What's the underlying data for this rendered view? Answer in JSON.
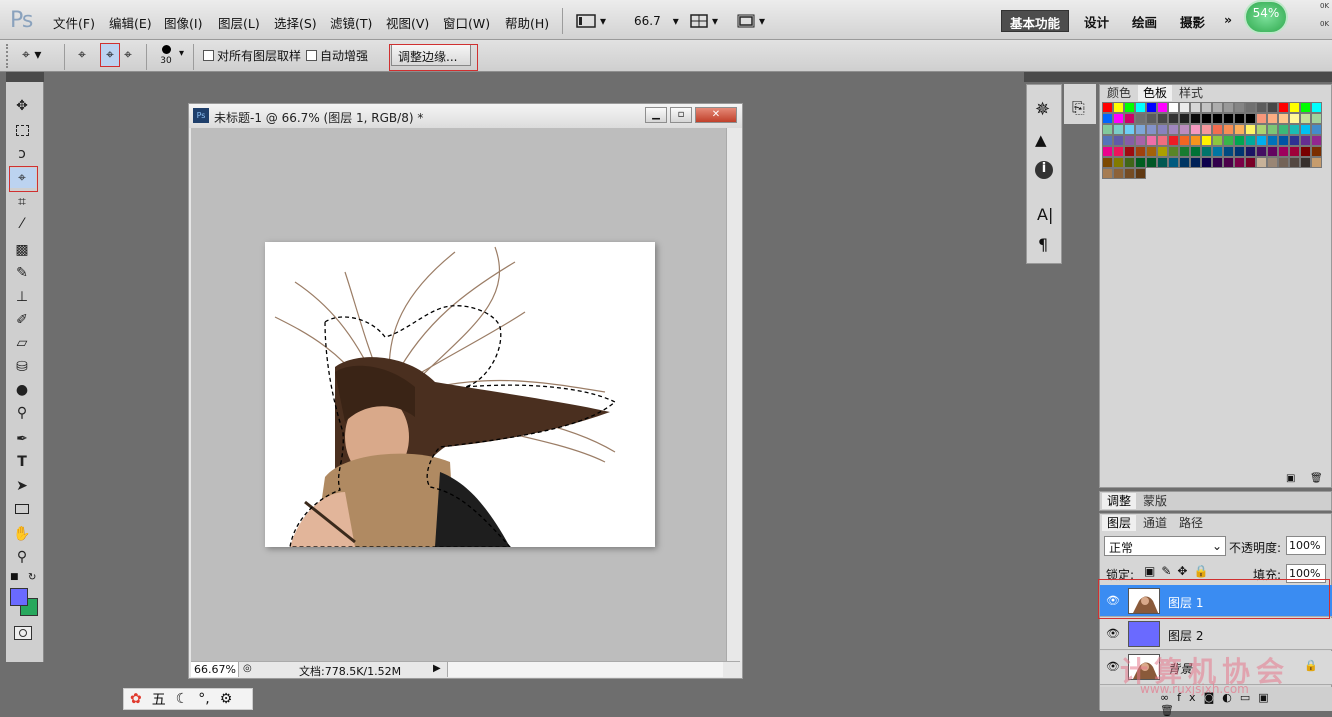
{
  "app": {
    "logo": "Ps"
  },
  "menu": [
    "文件(F)",
    "编辑(E)",
    "图像(I)",
    "图层(L)",
    "选择(S)",
    "滤镜(T)",
    "视图(V)",
    "窗口(W)",
    "帮助(H)"
  ],
  "menubar": {
    "zoom": "66.7",
    "zoom_dropdown": "▾"
  },
  "workspaces": {
    "active": "基本功能",
    "items": [
      "设计",
      "绘画",
      "摄影"
    ],
    "more": "»"
  },
  "tray": {
    "badge": "54%",
    "net_up": "0K",
    "net_down": "0K"
  },
  "options": {
    "brush_size": "30",
    "sample_all_layers": "对所有图层取样",
    "auto_enhance": "自动增强",
    "refine_edge": "调整边缘..."
  },
  "document": {
    "title": "未标题-1 @ 66.7% (图层 1, RGB/8) *",
    "zoom_status": "66.67%",
    "doc_size": "文档:778.5K/1.52M",
    "ps_badge": "Ps"
  },
  "swatch_tabs": [
    "颜色",
    "色板",
    "样式"
  ],
  "swatch_active": 1,
  "swatch_colors": [
    "#ff0000",
    "#ffff00",
    "#00ff00",
    "#00ffff",
    "#0000ff",
    "#ff00ff",
    "#ffffff",
    "#ebebeb",
    "#d6d6d6",
    "#c2c2c2",
    "#adadad",
    "#999999",
    "#858585",
    "#707070",
    "#5c5c5c",
    "#474747",
    "#ff0000",
    "#ffff00",
    "#00ff00",
    "#00ffff",
    "#0066ff",
    "#ff00ff",
    "#cc0066",
    "#707070",
    "#5c5c5c",
    "#474747",
    "#333333",
    "#1f1f1f",
    "#0a0a0a",
    "#000000",
    "#000000",
    "#000000",
    "#000000",
    "#000000",
    "#f7977a",
    "#fbad82",
    "#fdc68c",
    "#fff799",
    "#c4df9b",
    "#a3d39c",
    "#82ca9c",
    "#7bcdc8",
    "#6ecff6",
    "#7ea7d8",
    "#8493ca",
    "#8882be",
    "#a187be",
    "#bc8dbf",
    "#f49ac1",
    "#f5989d",
    "#f26c4f",
    "#f68e55",
    "#fbaf5c",
    "#fff467",
    "#acd372",
    "#7cc576",
    "#3bb878",
    "#1abbb4",
    "#00bff3",
    "#438ccb",
    "#5574b9",
    "#605ca8",
    "#855fa8",
    "#a763a9",
    "#ef6ea8",
    "#f16d7e",
    "#ed1c24",
    "#f26522",
    "#f7941d",
    "#fff200",
    "#8dc63f",
    "#39b54a",
    "#00a651",
    "#00a99d",
    "#00aeef",
    "#0072bc",
    "#0054a5",
    "#2e3192",
    "#662d91",
    "#92278f",
    "#ec008c",
    "#ed145b",
    "#9e0b0f",
    "#a0410d",
    "#a3620a",
    "#aba000",
    "#598527",
    "#197b30",
    "#007236",
    "#00746b",
    "#0076a3",
    "#004a80",
    "#003471",
    "#1b1464",
    "#440e62",
    "#630460",
    "#9e005d",
    "#9e0039",
    "#790000",
    "#7b2e00",
    "#7d4900",
    "#827b00",
    "#406618",
    "#005e20",
    "#005826",
    "#005952",
    "#005b7f",
    "#003663",
    "#002157",
    "#0d004c",
    "#32004b",
    "#4b0049",
    "#7b0046",
    "#7a0026",
    "#c7b299",
    "#998675",
    "#736357",
    "#534741",
    "#37302d",
    "#c69c6d",
    "#a67c52",
    "#8c6239",
    "#754c24",
    "#603913"
  ],
  "adjust_tabs": [
    "调整",
    "蒙版"
  ],
  "layer_tabs": [
    "图层",
    "通道",
    "路径"
  ],
  "layers_panel": {
    "blend_mode": "正常",
    "opacity_label": "不透明度:",
    "opacity": "100%",
    "lock_label": "锁定:",
    "fill_label": "填充:",
    "fill": "100%"
  },
  "layers": [
    {
      "name": "图层 1",
      "selected": true
    },
    {
      "name": "图层 2",
      "selected": false
    },
    {
      "name": "背景",
      "selected": false
    }
  ],
  "watermark": {
    "text": "计算机协会",
    "url": "www.ruxjsjxh.com"
  },
  "ime": [
    "五"
  ]
}
